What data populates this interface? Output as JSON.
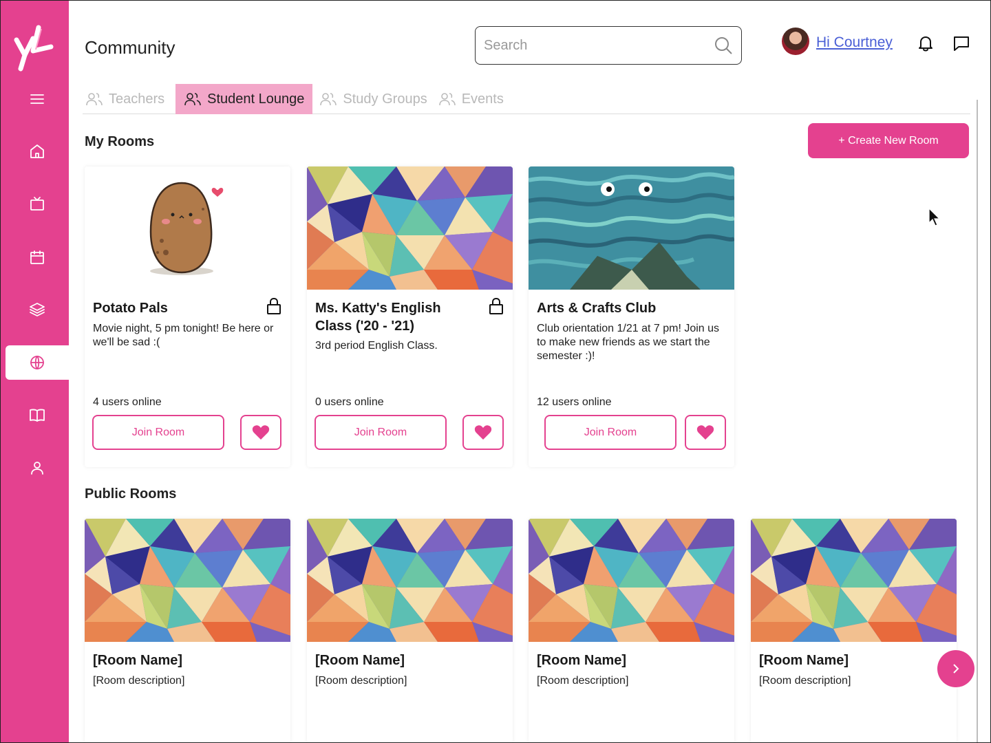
{
  "app": {
    "page_title": "Community"
  },
  "colors": {
    "brand": "#e4418f",
    "tab_active": "#f3a7c9",
    "link": "#4a5fd6"
  },
  "header": {
    "search_placeholder": "Search",
    "greeting": "Hi Courtney",
    "icons": [
      "search-icon",
      "bell-icon",
      "chat-icon"
    ]
  },
  "sidebar": {
    "items": [
      {
        "name": "menu",
        "icon": "hamburger-icon"
      },
      {
        "name": "home",
        "icon": "home-icon"
      },
      {
        "name": "tv",
        "icon": "tv-icon"
      },
      {
        "name": "calendar",
        "icon": "calendar-icon"
      },
      {
        "name": "layers",
        "icon": "layers-icon"
      },
      {
        "name": "community",
        "icon": "globe-icon",
        "active": true
      },
      {
        "name": "library",
        "icon": "book-icon"
      },
      {
        "name": "profile",
        "icon": "user-icon"
      }
    ]
  },
  "tabs": [
    {
      "label": "Teachers",
      "active": false
    },
    {
      "label": "Student Lounge",
      "active": true
    },
    {
      "label": "Study Groups",
      "active": false
    },
    {
      "label": "Events",
      "active": false
    }
  ],
  "my_rooms": {
    "title": "My Rooms",
    "create_label": "+ Create New Room",
    "rooms": [
      {
        "name": "Potato Pals",
        "description": "Movie night, 5 pm tonight! Be here or we'll be sad :(",
        "users": "4 users online",
        "locked": true,
        "join_label": "Join Room"
      },
      {
        "name_line1": "Ms. Katty's English",
        "name_line2": "Class ('20 - '21)",
        "description": "3rd period English Class.",
        "users": "0 users online",
        "locked": true,
        "join_label": "Join Room"
      },
      {
        "name": "Arts & Crafts Club",
        "description": "Club orientation 1/21 at 7 pm! Join us to make new friends as we start the semester :)!",
        "users": "12 users online",
        "locked": false,
        "join_label": "Join Room"
      }
    ]
  },
  "public_rooms": {
    "title": "Public Rooms",
    "rooms": [
      {
        "name": "[Room Name]",
        "description": "[Room description]"
      },
      {
        "name": "[Room Name]",
        "description": "[Room description]"
      },
      {
        "name": "[Room Name]",
        "description": "[Room description]"
      },
      {
        "name": "[Room Name]",
        "description": "[Room description]"
      }
    ]
  }
}
